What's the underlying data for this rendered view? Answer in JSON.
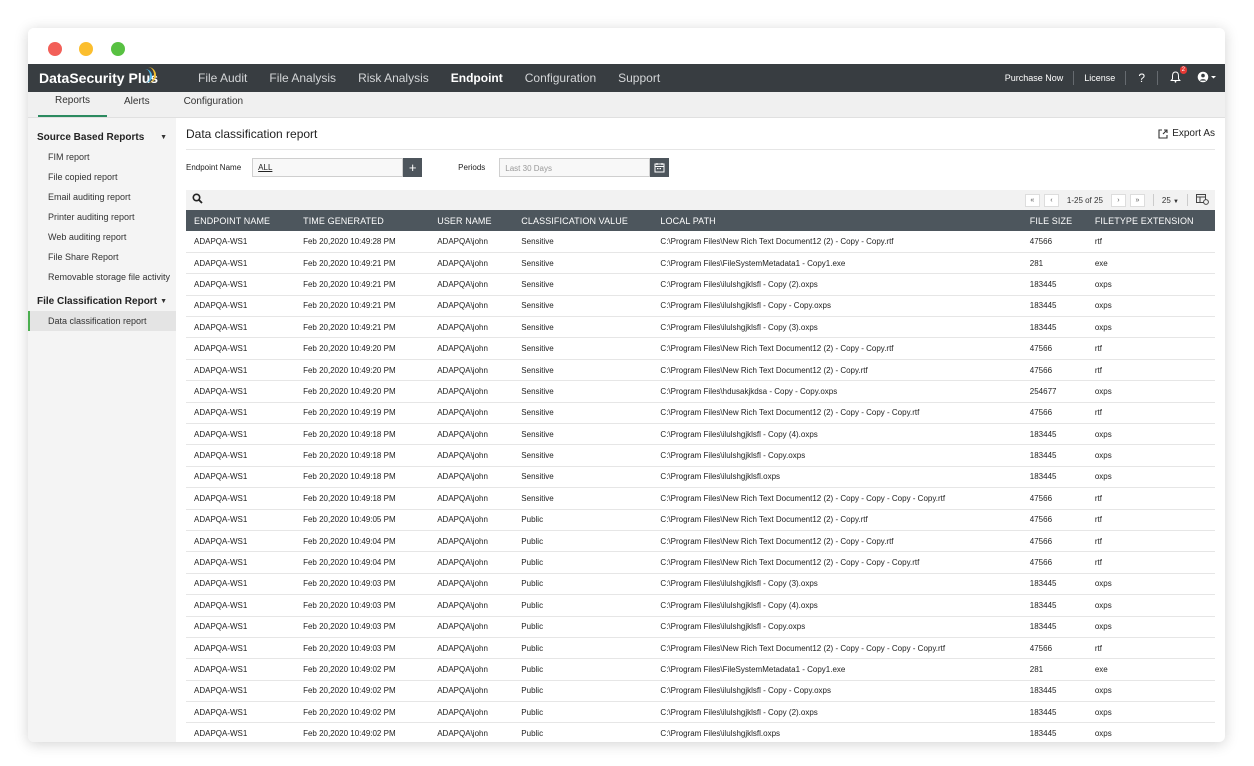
{
  "app": {
    "brand": "DataSecurity Plus",
    "nav": [
      "File Audit",
      "File Analysis",
      "Risk Analysis",
      "Endpoint",
      "Configuration",
      "Support"
    ],
    "active_nav": "Endpoint",
    "purchase": "Purchase Now",
    "license": "License",
    "help": "?",
    "notification_count": "2"
  },
  "subnav": {
    "tabs": [
      "Reports",
      "Alerts",
      "Configuration"
    ],
    "active": "Reports"
  },
  "sidebar": {
    "section1": "Source Based Reports",
    "items1": [
      "FIM report",
      "File copied report",
      "Email auditing report",
      "Printer auditing report",
      "Web auditing report",
      "File Share Report",
      "Removable storage file activity"
    ],
    "section2": "File Classification Report",
    "items2": [
      "Data classification report"
    ]
  },
  "report": {
    "title": "Data classification report",
    "export_label": "Export As",
    "endpoint_label": "Endpoint Name",
    "endpoint_value": "ALL",
    "periods_label": "Periods",
    "periods_placeholder": "Last 30 Days",
    "page_range": "1-25 of 25",
    "page_size": "25"
  },
  "table": {
    "columns": [
      "ENDPOINT NAME",
      "TIME GENERATED",
      "USER NAME",
      "CLASSIFICATION VALUE",
      "LOCAL PATH",
      "FILE SIZE",
      "FILETYPE EXTENSION"
    ],
    "rows": [
      [
        "ADAPQA-WS1",
        "Feb 20,2020 10:49:28 PM",
        "ADAPQA\\john",
        "Sensitive",
        "C:\\Program Files\\New Rich Text Document12 (2) - Copy - Copy.rtf",
        "47566",
        "rtf"
      ],
      [
        "ADAPQA-WS1",
        "Feb 20,2020 10:49:21 PM",
        "ADAPQA\\john",
        "Sensitive",
        "C:\\Program Files\\FileSystemMetadata1 - Copy1.exe",
        "281",
        "exe"
      ],
      [
        "ADAPQA-WS1",
        "Feb 20,2020 10:49:21 PM",
        "ADAPQA\\john",
        "Sensitive",
        "C:\\Program Files\\ilulshgjklsfl - Copy (2).oxps",
        "183445",
        "oxps"
      ],
      [
        "ADAPQA-WS1",
        "Feb 20,2020 10:49:21 PM",
        "ADAPQA\\john",
        "Sensitive",
        "C:\\Program Files\\ilulshgjklsfl - Copy - Copy.oxps",
        "183445",
        "oxps"
      ],
      [
        "ADAPQA-WS1",
        "Feb 20,2020 10:49:21 PM",
        "ADAPQA\\john",
        "Sensitive",
        "C:\\Program Files\\ilulshgjklsfl - Copy (3).oxps",
        "183445",
        "oxps"
      ],
      [
        "ADAPQA-WS1",
        "Feb 20,2020 10:49:20 PM",
        "ADAPQA\\john",
        "Sensitive",
        "C:\\Program Files\\New Rich Text Document12 (2) - Copy - Copy.rtf",
        "47566",
        "rtf"
      ],
      [
        "ADAPQA-WS1",
        "Feb 20,2020 10:49:20 PM",
        "ADAPQA\\john",
        "Sensitive",
        "C:\\Program Files\\New Rich Text Document12 (2) - Copy.rtf",
        "47566",
        "rtf"
      ],
      [
        "ADAPQA-WS1",
        "Feb 20,2020 10:49:20 PM",
        "ADAPQA\\john",
        "Sensitive",
        "C:\\Program Files\\hdusakjkdsa - Copy - Copy.oxps",
        "254677",
        "oxps"
      ],
      [
        "ADAPQA-WS1",
        "Feb 20,2020 10:49:19 PM",
        "ADAPQA\\john",
        "Sensitive",
        "C:\\Program Files\\New Rich Text Document12 (2) - Copy - Copy - Copy.rtf",
        "47566",
        "rtf"
      ],
      [
        "ADAPQA-WS1",
        "Feb 20,2020 10:49:18 PM",
        "ADAPQA\\john",
        "Sensitive",
        "C:\\Program Files\\ilulshgjklsfl - Copy (4).oxps",
        "183445",
        "oxps"
      ],
      [
        "ADAPQA-WS1",
        "Feb 20,2020 10:49:18 PM",
        "ADAPQA\\john",
        "Sensitive",
        "C:\\Program Files\\ilulshgjklsfl - Copy.oxps",
        "183445",
        "oxps"
      ],
      [
        "ADAPQA-WS1",
        "Feb 20,2020 10:49:18 PM",
        "ADAPQA\\john",
        "Sensitive",
        "C:\\Program Files\\ilulshgjklsfl.oxps",
        "183445",
        "oxps"
      ],
      [
        "ADAPQA-WS1",
        "Feb 20,2020 10:49:18 PM",
        "ADAPQA\\john",
        "Sensitive",
        "C:\\Program Files\\New Rich Text Document12 (2) - Copy - Copy - Copy - Copy.rtf",
        "47566",
        "rtf"
      ],
      [
        "ADAPQA-WS1",
        "Feb 20,2020 10:49:05 PM",
        "ADAPQA\\john",
        "Public",
        "C:\\Program Files\\New Rich Text Document12 (2) - Copy.rtf",
        "47566",
        "rtf"
      ],
      [
        "ADAPQA-WS1",
        "Feb 20,2020 10:49:04 PM",
        "ADAPQA\\john",
        "Public",
        "C:\\Program Files\\New Rich Text Document12 (2) - Copy - Copy.rtf",
        "47566",
        "rtf"
      ],
      [
        "ADAPQA-WS1",
        "Feb 20,2020 10:49:04 PM",
        "ADAPQA\\john",
        "Public",
        "C:\\Program Files\\New Rich Text Document12 (2) - Copy - Copy - Copy.rtf",
        "47566",
        "rtf"
      ],
      [
        "ADAPQA-WS1",
        "Feb 20,2020 10:49:03 PM",
        "ADAPQA\\john",
        "Public",
        "C:\\Program Files\\ilulshgjklsfl - Copy (3).oxps",
        "183445",
        "oxps"
      ],
      [
        "ADAPQA-WS1",
        "Feb 20,2020 10:49:03 PM",
        "ADAPQA\\john",
        "Public",
        "C:\\Program Files\\ilulshgjklsfl - Copy (4).oxps",
        "183445",
        "oxps"
      ],
      [
        "ADAPQA-WS1",
        "Feb 20,2020 10:49:03 PM",
        "ADAPQA\\john",
        "Public",
        "C:\\Program Files\\ilulshgjklsfl - Copy.oxps",
        "183445",
        "oxps"
      ],
      [
        "ADAPQA-WS1",
        "Feb 20,2020 10:49:03 PM",
        "ADAPQA\\john",
        "Public",
        "C:\\Program Files\\New Rich Text Document12 (2) - Copy - Copy - Copy - Copy.rtf",
        "47566",
        "rtf"
      ],
      [
        "ADAPQA-WS1",
        "Feb 20,2020 10:49:02 PM",
        "ADAPQA\\john",
        "Public",
        "C:\\Program Files\\FileSystemMetadata1 - Copy1.exe",
        "281",
        "exe"
      ],
      [
        "ADAPQA-WS1",
        "Feb 20,2020 10:49:02 PM",
        "ADAPQA\\john",
        "Public",
        "C:\\Program Files\\ilulshgjklsfl - Copy - Copy.oxps",
        "183445",
        "oxps"
      ],
      [
        "ADAPQA-WS1",
        "Feb 20,2020 10:49:02 PM",
        "ADAPQA\\john",
        "Public",
        "C:\\Program Files\\ilulshgjklsfl - Copy (2).oxps",
        "183445",
        "oxps"
      ],
      [
        "ADAPQA-WS1",
        "Feb 20,2020 10:49:02 PM",
        "ADAPQA\\john",
        "Public",
        "C:\\Program Files\\ilulshgjklsfl.oxps",
        "183445",
        "oxps"
      ]
    ]
  }
}
